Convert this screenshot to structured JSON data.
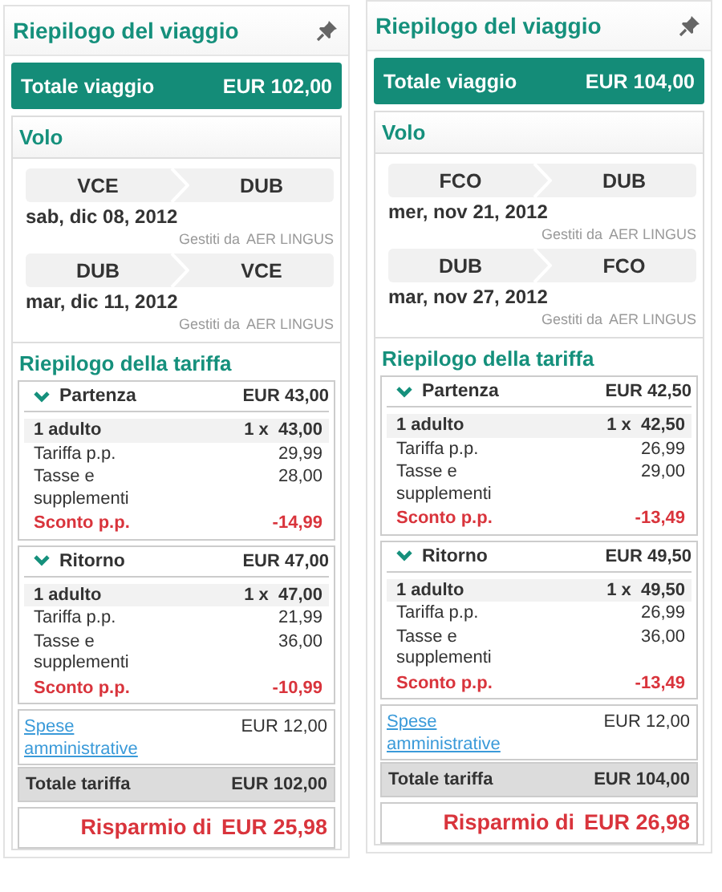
{
  "panels": [
    {
      "title": "Riepilogo del viaggio",
      "total": {
        "label": "Totale viaggio",
        "value": "EUR 102,00"
      },
      "flight_section": "Volo",
      "flights": [
        {
          "from": "VCE",
          "to": "DUB",
          "date": "sab, dic 08, 2012",
          "operated_label": "Gestiti da",
          "airline": "AER LINGUS"
        },
        {
          "from": "DUB",
          "to": "VCE",
          "date": "mar, dic 11, 2012",
          "operated_label": "Gestiti da",
          "airline": "AER LINGUS"
        }
      ],
      "fare_section": "Riepilogo della tariffa",
      "legs": [
        {
          "name": "Partenza",
          "total": "EUR 43,00",
          "expanded": true,
          "passenger": "1 adulto",
          "quantity": "1 x  43,00",
          "fare_label": "Tariffa p.p.",
          "fare": "29,99",
          "taxes_label": "Tasse e supplementi",
          "taxes": "28,00",
          "discount_label": "Sconto p.p.",
          "discount": "-14,99"
        },
        {
          "name": "Ritorno",
          "total": "EUR 47,00",
          "expanded": true,
          "passenger": "1 adulto",
          "quantity": "1 x  47,00",
          "fare_label": "Tariffa p.p.",
          "fare": "21,99",
          "taxes_label": "Tasse e supplementi",
          "taxes": "36,00",
          "discount_label": "Sconto p.p.",
          "discount": "-10,99"
        }
      ],
      "fees": {
        "label": "Spese amministrative",
        "value": "EUR 12,00"
      },
      "fare_total": {
        "label": "Totale tariffa",
        "value": "EUR 102,00"
      },
      "savings": {
        "label": "Risparmio di",
        "value": "EUR 25,98"
      }
    },
    {
      "title": "Riepilogo del viaggio",
      "total": {
        "label": "Totale viaggio",
        "value": "EUR 104,00"
      },
      "flight_section": "Volo",
      "flights": [
        {
          "from": "FCO",
          "to": "DUB",
          "date": "mer, nov 21, 2012",
          "operated_label": "Gestiti da",
          "airline": "AER LINGUS"
        },
        {
          "from": "DUB",
          "to": "FCO",
          "date": "mar, nov 27, 2012",
          "operated_label": "Gestiti da",
          "airline": "AER LINGUS"
        }
      ],
      "fare_section": "Riepilogo della tariffa",
      "legs": [
        {
          "name": "Partenza",
          "total": "EUR 42,50",
          "expanded": true,
          "passenger": "1 adulto",
          "quantity": "1 x  42,50",
          "fare_label": "Tariffa p.p.",
          "fare": "26,99",
          "taxes_label": "Tasse e supplementi",
          "taxes": "29,00",
          "discount_label": "Sconto p.p.",
          "discount": "-13,49"
        },
        {
          "name": "Ritorno",
          "total": "EUR 49,50",
          "expanded": true,
          "passenger": "1 adulto",
          "quantity": "1 x  49,50",
          "fare_label": "Tariffa p.p.",
          "fare": "26,99",
          "taxes_label": "Tasse e supplementi",
          "taxes": "36,00",
          "discount_label": "Sconto p.p.",
          "discount": "-13,49"
        }
      ],
      "fees": {
        "label": "Spese amministrative",
        "value": "EUR 12,00"
      },
      "fare_total": {
        "label": "Totale tariffa",
        "value": "EUR 104,00"
      },
      "savings": {
        "label": "Risparmio di",
        "value": "EUR 26,98"
      }
    }
  ]
}
